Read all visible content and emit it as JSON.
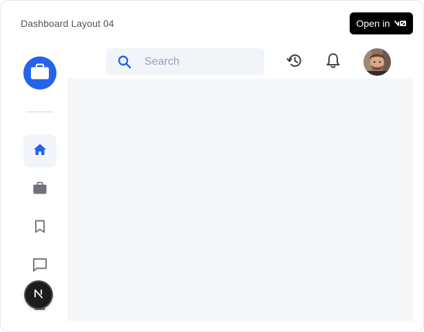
{
  "header": {
    "title": "Dashboard Layout 04",
    "open_in_label": "Open in",
    "open_in_logo": "v0-logo"
  },
  "sidebar": {
    "logo_icon": "briefcase-icon",
    "accent_color": "#2563eb",
    "items": [
      {
        "name": "home",
        "icon": "home-icon",
        "active": true
      },
      {
        "name": "briefcase",
        "icon": "briefcase-icon",
        "active": false
      },
      {
        "name": "bookmark",
        "icon": "bookmark-icon",
        "active": false
      },
      {
        "name": "messages",
        "icon": "message-icon",
        "active": false
      },
      {
        "name": "extra",
        "icon": "user-icon",
        "active": false
      }
    ]
  },
  "topbar": {
    "search": {
      "placeholder": "Search",
      "value": ""
    },
    "history_icon": "history-icon",
    "notifications_icon": "bell-icon",
    "avatar_icon": "user-avatar"
  },
  "floating_badge_icon": "next-logo-icon"
}
